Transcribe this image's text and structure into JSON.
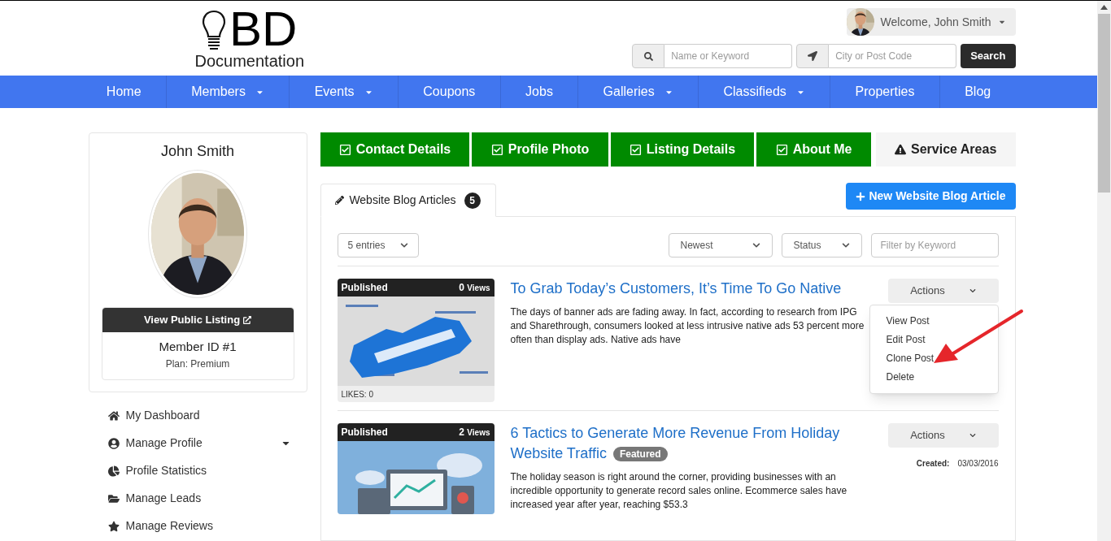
{
  "header": {
    "logo": {
      "letters": "BD",
      "tagline": "Documentation"
    },
    "user_menu": {
      "greeting": "Welcome, John Smith"
    },
    "search": {
      "keyword_placeholder": "Name or Keyword",
      "location_placeholder": "City or Post Code",
      "button": "Search"
    }
  },
  "nav": [
    {
      "label": "Home",
      "has_dropdown": false
    },
    {
      "label": "Members",
      "has_dropdown": true
    },
    {
      "label": "Events",
      "has_dropdown": true
    },
    {
      "label": "Coupons",
      "has_dropdown": false
    },
    {
      "label": "Jobs",
      "has_dropdown": false
    },
    {
      "label": "Galleries",
      "has_dropdown": true
    },
    {
      "label": "Classifieds",
      "has_dropdown": true
    },
    {
      "label": "Properties",
      "has_dropdown": false
    },
    {
      "label": "Blog",
      "has_dropdown": false
    }
  ],
  "sidebar": {
    "name": "John Smith",
    "public_listing_button": "View Public Listing",
    "member_id": "Member ID #1",
    "plan": "Plan: Premium",
    "menu": [
      {
        "label": "My Dashboard",
        "kind": "dashboard",
        "has_submenu": false
      },
      {
        "label": "Manage Profile",
        "kind": "profile",
        "has_submenu": true
      },
      {
        "label": "Profile Statistics",
        "kind": "statistics",
        "has_submenu": false
      },
      {
        "label": "Manage Leads",
        "kind": "leads",
        "has_submenu": false
      },
      {
        "label": "Manage Reviews",
        "kind": "reviews",
        "has_submenu": false
      }
    ]
  },
  "profile_steps": [
    {
      "label": "Contact Details",
      "complete": true
    },
    {
      "label": "Profile Photo",
      "complete": true
    },
    {
      "label": "Listing Details",
      "complete": true
    },
    {
      "label": "About Me",
      "complete": true
    },
    {
      "label": "Service Areas",
      "complete": false
    }
  ],
  "section_tab": {
    "label": "Website Blog Articles",
    "count": "5",
    "selected": true
  },
  "new_button": "New Website Blog Article",
  "filters": {
    "entries": "5 entries",
    "sort": "Newest",
    "status": "Status",
    "keyword_placeholder": "Filter by Keyword"
  },
  "posts": [
    {
      "status": "Published",
      "views": "0",
      "views_label": "Views",
      "title": "To Grab Today’s Customers, It’s Time To Go Native",
      "excerpt": "The days of banner ads are fading away. In fact, according to research from IPG and Sharethrough, consumers looked at less intrusive native ads 53 percent more often than display ads. Native ads have",
      "likes": "LIKES: 0",
      "actions_label": "Actions",
      "menu": [
        "View Post",
        "Edit Post",
        "Clone Post",
        "Delete"
      ]
    },
    {
      "status": "Published",
      "views": "2",
      "views_label": "Views",
      "title": "6 Tactics to Generate More Revenue From Holiday Website Traffic",
      "badge": "Featured",
      "excerpt": "The holiday season is right around the corner, providing businesses with an incredible opportunity to generate record sales online. Ecommerce sales have increased year after year, reaching $53.3",
      "actions_label": "Actions",
      "created_label": "Created:",
      "created_date": "03/03/2016"
    }
  ]
}
